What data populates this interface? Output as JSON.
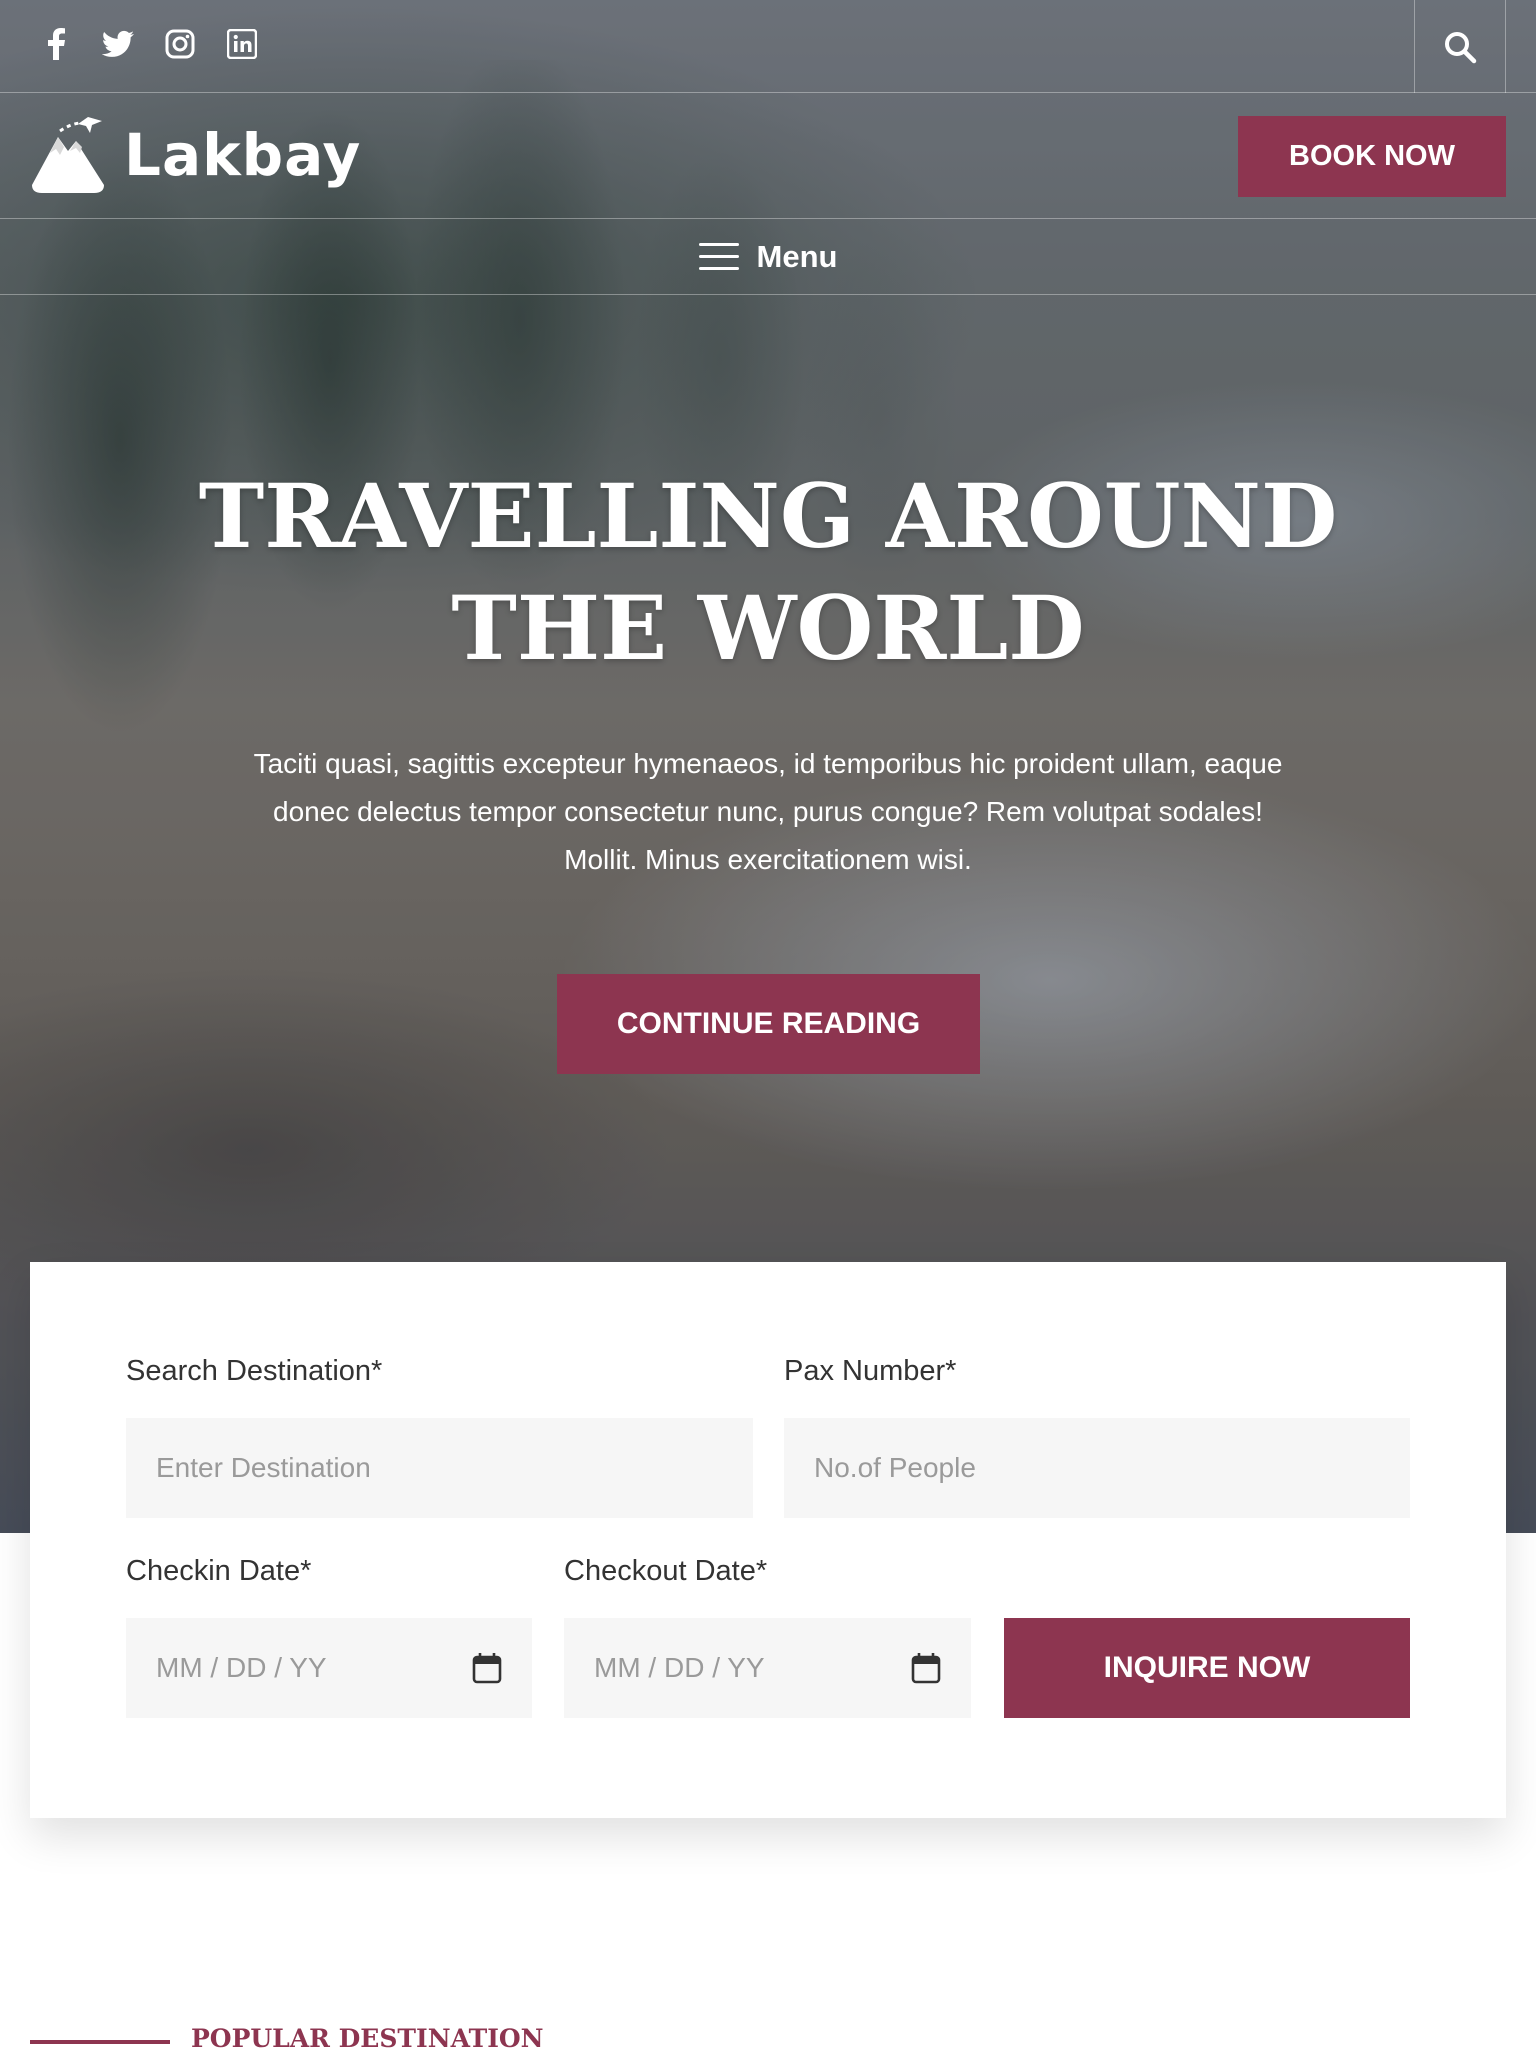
{
  "social": [
    {
      "name": "facebook-icon"
    },
    {
      "name": "twitter-icon"
    },
    {
      "name": "instagram-icon"
    },
    {
      "name": "linkedin-icon"
    }
  ],
  "brand": {
    "name": "Lakbay"
  },
  "header": {
    "book_label": "BOOK NOW",
    "menu_label": "Menu"
  },
  "hero": {
    "title_line1": "TRAVELLING AROUND",
    "title_line2": "THE WORLD",
    "text_line1": "Taciti quasi, sagittis excepteur hymenaeos, id temporibus hic proident ullam, eaque",
    "text_line2": "donec delectus tempor consectetur nunc, purus congue? Rem volutpat sodales!",
    "text_line3": "Mollit. Minus exercitationem wisi.",
    "button_label": "CONTINUE READING"
  },
  "form": {
    "destination_label": "Search Destination*",
    "destination_placeholder": "Enter Destination",
    "pax_label": "Pax Number*",
    "pax_placeholder": "No.of People",
    "checkin_label": "Checkin Date*",
    "checkin_placeholder": "MM / DD / YY",
    "checkout_label": "Checkout Date*",
    "checkout_placeholder": "MM / DD / YY",
    "submit_label": "INQUIRE NOW"
  },
  "section": {
    "title": "POPULAR DESTINATION"
  },
  "colors": {
    "accent": "#8d3550",
    "field_bg": "#f6f6f6"
  }
}
